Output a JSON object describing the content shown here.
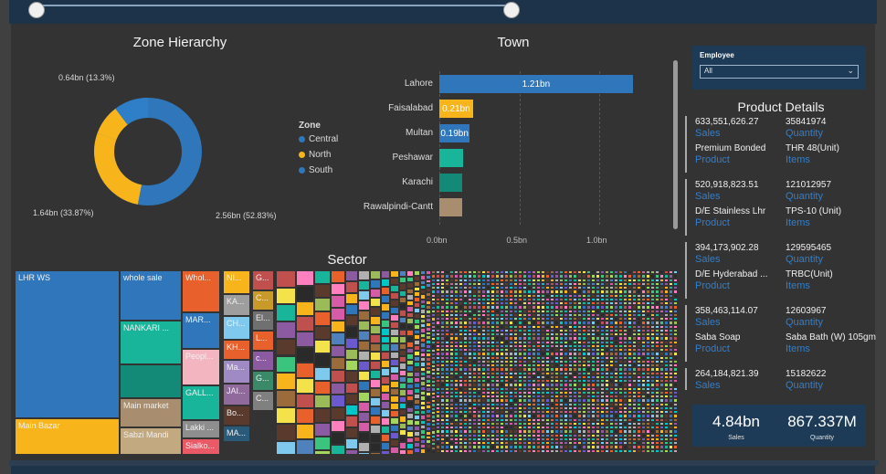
{
  "colors": {
    "central": "#2f76bb",
    "north": "#f7b51b",
    "south": "#2f76bb",
    "bar_blue": "#2f76bb",
    "bar_yellow": "#f7b51b",
    "teal": "#18b59a",
    "darkteal": "#138a78",
    "tan": "#a88d6e"
  },
  "zone": {
    "title": "Zone Hierarchy",
    "labels": {
      "top": "0.64bn (13.3%)",
      "left": "1.64bn (33.87%)",
      "right": "2.56bn (52.83%)"
    },
    "legend_title": "Zone",
    "legend": [
      "Central",
      "North",
      "South"
    ]
  },
  "town": {
    "title": "Town",
    "bars": [
      {
        "name": "Lahore",
        "value": 1.21,
        "label": "1.21bn",
        "color": "#2f76bb"
      },
      {
        "name": "Faisalabad",
        "value": 0.21,
        "label": "0.21bn",
        "color": "#f7b51b"
      },
      {
        "name": "Multan",
        "value": 0.19,
        "label": "0.19bn",
        "color": "#2f76bb"
      },
      {
        "name": "Peshawar",
        "value": 0.15,
        "label": "",
        "color": "#18b59a"
      },
      {
        "name": "Karachi",
        "value": 0.14,
        "label": "",
        "color": "#138a78"
      },
      {
        "name": "Rawalpindi-Cantt",
        "value": 0.14,
        "label": "",
        "color": "#a88d6e"
      }
    ],
    "ticks": [
      "0.0bn",
      "0.5bn",
      "1.0bn"
    ]
  },
  "sector": {
    "title": "Sector",
    "cells": [
      "LHR WS",
      "Main Bazar",
      "whole sale",
      "NANKARI ...",
      "Main market",
      "Sabzi Mandi",
      "Whol...",
      "MAR...",
      "Peopl...",
      "GALL...",
      "Lakki ...",
      "Sialko...",
      "NI...",
      "KA...",
      "CH...",
      "KH...",
      "Ma...",
      "JAI...",
      "Bo...",
      "MA...",
      "G...",
      "C...",
      "El...",
      "L...",
      "c...",
      "G...",
      "C..."
    ]
  },
  "employee": {
    "title": "Employee",
    "selected": "All"
  },
  "product_details": {
    "title": "Product Details",
    "cards": [
      {
        "sales": "633,551,626.27",
        "quantity": "35841974",
        "product": "Premium Bonded",
        "items": "THR 48(Unit)"
      },
      {
        "sales": "520,918,823.51",
        "quantity": "121012957",
        "product": "D/E Stainless Lhr",
        "items": "TPS-10 (Unit)"
      },
      {
        "sales": "394,173,902.28",
        "quantity": "129595465",
        "product": "D/E Hyderabad ...",
        "items": "TRBC(Unit)"
      },
      {
        "sales": "358,463,114.07",
        "quantity": "12603967",
        "product": "Saba Soap",
        "items": "Saba Bath (W) 105gm"
      },
      {
        "sales": "264,184,821.39",
        "quantity": "15182622",
        "product": "",
        "items": ""
      }
    ],
    "labels": {
      "sales": "Sales",
      "quantity": "Quantity",
      "product": "Product",
      "items": "Items"
    }
  },
  "kpi": {
    "sales_value": "4.84bn",
    "sales_label": "Sales",
    "quantity_value": "867.337M",
    "quantity_label": "Quantity"
  }
}
